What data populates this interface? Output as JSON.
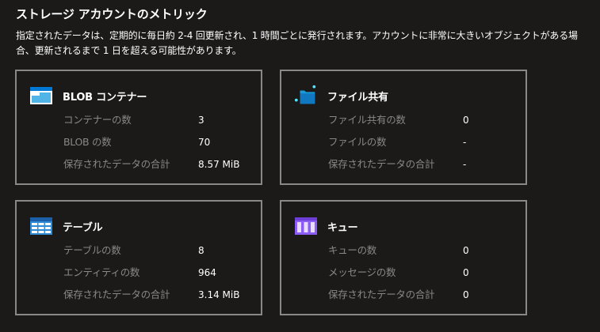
{
  "page": {
    "title": "ストレージ アカウントのメトリック",
    "description": "指定されたデータは、定期的に毎日約 2-4 回更新され、1 時間ごとに発行されます。アカウントに非常に大きいオブジェクトがある場合、更新されるまで 1 日を超える可能性があります。"
  },
  "colors": {
    "background": "#1b1a19",
    "border": "#8a8886",
    "label": "#8a8886",
    "text": "#ffffff",
    "blob_icon": "#50b4e6",
    "file_icon": "#1a9bd7",
    "table_icon": "#2f8ad8",
    "queue_icon": "#8b5cf6"
  },
  "cards": {
    "blob": {
      "icon": "blob-container-icon",
      "title": "BLOB コンテナー",
      "rows": [
        {
          "label": "コンテナーの数",
          "value": "3"
        },
        {
          "label": "BLOB の数",
          "value": "70"
        },
        {
          "label": "保存されたデータの合計",
          "value": "8.57 MiB"
        }
      ]
    },
    "file": {
      "icon": "file-share-icon",
      "title": "ファイル共有",
      "rows": [
        {
          "label": "ファイル共有の数",
          "value": "0"
        },
        {
          "label": "ファイルの数",
          "value": "-"
        },
        {
          "label": "保存されたデータの合計",
          "value": "-"
        }
      ]
    },
    "table": {
      "icon": "table-icon",
      "title": "テーブル",
      "rows": [
        {
          "label": "テーブルの数",
          "value": "8"
        },
        {
          "label": "エンティティの数",
          "value": "964"
        },
        {
          "label": "保存されたデータの合計",
          "value": "3.14 MiB"
        }
      ]
    },
    "queue": {
      "icon": "queue-icon",
      "title": "キュー",
      "rows": [
        {
          "label": "キューの数",
          "value": "0"
        },
        {
          "label": "メッセージの数",
          "value": "0"
        },
        {
          "label": "保存されたデータの合計",
          "value": "0"
        }
      ]
    }
  }
}
